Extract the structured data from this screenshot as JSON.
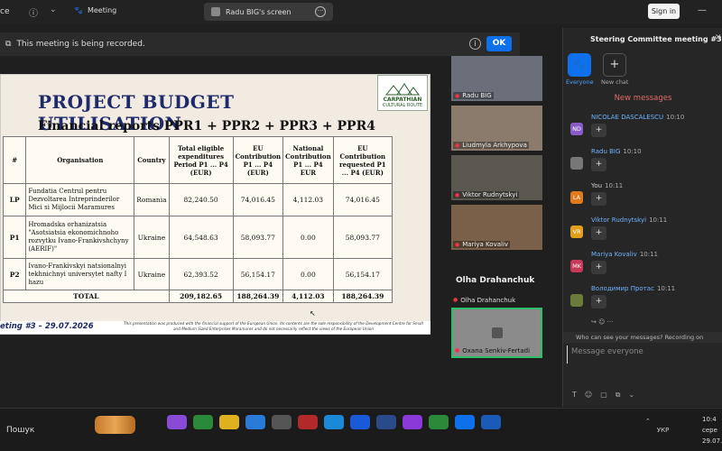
{
  "topbar": {
    "app_fragment": "ce",
    "meeting_label": "Meeting",
    "share_tab_label": "Radu BIG's screen",
    "signin_label": "Sign in",
    "minimize_symbol": "—"
  },
  "recording": {
    "message": "This meeting is being recorded.",
    "ok_label": "OK"
  },
  "slide": {
    "title": "PROJECT BUDGET UTILISATION",
    "logo_name": "CARPATHIAN",
    "logo_sub": "CULTURAL ROUTE",
    "subtitle": "Financial reports PPR1 + PPR2 + PPR3 + PPR4",
    "table": {
      "headers": [
        "#",
        "Organisation",
        "Country",
        "Total eligible expenditures Period P1 ... P4 (EUR)",
        "EU Contribution P1 ... P4 (EUR)",
        "National Contribution P1 ... P4 EUR",
        "EU Contribution requested P1 ... P4 (EUR)"
      ],
      "rows": [
        {
          "id": "LP",
          "org": "Fundatia Centrul pentru Dezvoltarea Intreprinderilor Mici si Mijlocii Maramures",
          "country": "Romania",
          "total": "82,240.50",
          "eu": "74,016.45",
          "national": "4,112.03",
          "requested": "74,016.45"
        },
        {
          "id": "P1",
          "org": "Hromadska orhanizatsia \"Asotsiatsia ekonomichnoho rozvytku Ivano-Frankivshchyny (AERIF)\"",
          "country": "Ukraine",
          "total": "64,548.63",
          "eu": "58,093.77",
          "national": "0.00",
          "requested": "58,093.77"
        },
        {
          "id": "P2",
          "org": "Ivano-Frankivskyi natsionalnyi tekhnichnyi universytet nafty I hazu",
          "country": "Ukraine",
          "total": "62,393.52",
          "eu": "56,154.17",
          "national": "0.00",
          "requested": "56,154.17"
        }
      ],
      "total_label": "TOTAL",
      "total_total": "209,182.65",
      "total_eu": "188,264.39",
      "total_national": "4,112.03",
      "total_requested": "188,264.39"
    },
    "footer_left": "eting #3 – 29.07.2026",
    "footer_note": "This presentation was produced with the financial support of the European Union. Its contents are the sole responsibility of the Development Centre for Small and Medium Sized Enterprises Maramures and do not necessarily reflect the views of the European Union"
  },
  "participants": [
    {
      "name": "Radu BIG",
      "color": "#6a6f7a"
    },
    {
      "name": "Liudmyla Arkhypova",
      "color": "#8b7b6c"
    },
    {
      "name": "Viktor Rudnytskyi",
      "color": "#5a5650"
    },
    {
      "name": "Mariya Kovaliv",
      "color": "#7a6048"
    }
  ],
  "olha": {
    "display": "Olha Drahanchuk",
    "label": "Olha Drahanchuk"
  },
  "oxana": {
    "label": "Oxana Senkiv-Fertadi"
  },
  "chat": {
    "title": "Steering Committee meeting #3",
    "everyone_label": "Everyone",
    "newchat_label": "New chat",
    "new_messages": "New messages",
    "messages": [
      {
        "initials": "ND",
        "color": "#8a5cc7",
        "name": "NICOLAE DASCALESCU",
        "time": "10:10"
      },
      {
        "initials": "",
        "color": "#777",
        "name": "Radu BIG",
        "time": "10:10"
      },
      {
        "initials": "LA",
        "color": "#e07a1c",
        "name": "You",
        "time": "10:11"
      },
      {
        "initials": "VR",
        "color": "#e0a01c",
        "name": "Viktor Rudnytskyi",
        "time": "10:11"
      },
      {
        "initials": "MK",
        "color": "#c7385a",
        "name": "Mariya Kovaliv",
        "time": "10:11"
      },
      {
        "initials": "",
        "color": "#6b7b3a",
        "name": "Володимир Протас",
        "time": "10:11"
      }
    ],
    "plus_symbol": "+",
    "who_can_see": "Who can see your messages? Recording on",
    "input_placeholder": "Message everyone"
  },
  "taskbar": {
    "search_label": "Пошук",
    "lang": "УКР",
    "time": "10:4",
    "date_line": "сере",
    "date": "29.07.2"
  }
}
